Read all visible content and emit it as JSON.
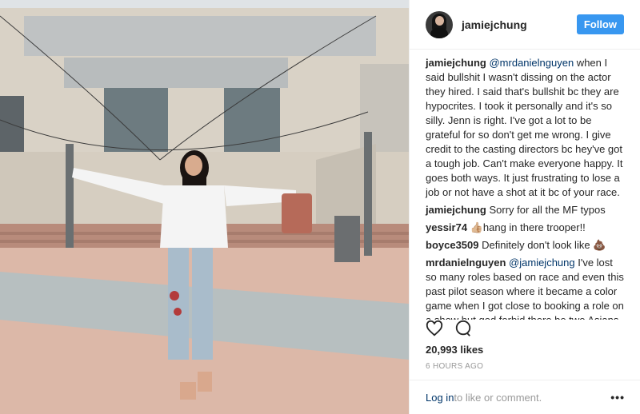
{
  "post": {
    "username": "jamiejchung",
    "follow_label": "Follow",
    "likes": "20,993 likes",
    "time_ago": "6 HOURS AGO",
    "login_link": "Log in",
    "login_text": " to like or comment.",
    "more_label": "•••"
  },
  "comments": [
    {
      "user": "jamiejchung",
      "mention": "@mrdanielnguyen",
      "text": " when I said bullshit I wasn't dissing on the actor they hired. I said that's bullshit bc they are hypocrites. I took it personally and it's so silly. Jenn is right. I've got a lot to be grateful for so don't get me wrong. I give credit to the casting directors bc hey've got a tough job. Can't make everyone happy. It goes both ways. It just frustrating to lose a job or not have a shot at it bc of your race."
    },
    {
      "user": "jamiejchung",
      "mention": "",
      "text": "Sorry for all the MF typos"
    },
    {
      "user": "yessir74",
      "mention": "",
      "text": "👍🏼hang in there trooper!!"
    },
    {
      "user": "boyce3509",
      "mention": "",
      "text": "Definitely don't look like 💩"
    },
    {
      "user": "mrdanielnguyen",
      "mention": "@jamiejchung",
      "text": " I've lost so many roles based on race and even this past pilot season where it became a color game when I got close to booking a role on a show but god forbid there be two Asians on a show. Casting directors do get it tough"
    }
  ],
  "colors": {
    "accent": "#3897f0",
    "link": "#003569"
  },
  "icons": [
    "heart-icon",
    "comment-icon",
    "more-icon"
  ]
}
